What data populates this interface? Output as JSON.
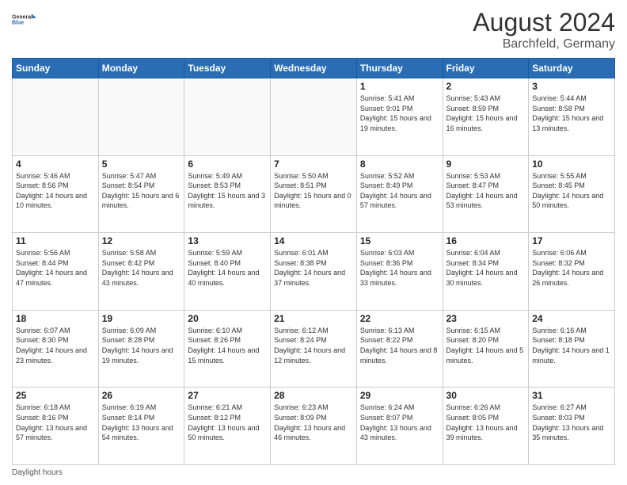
{
  "header": {
    "logo_general": "General",
    "logo_blue": "Blue",
    "month_year": "August 2024",
    "location": "Barchfeld, Germany"
  },
  "days_of_week": [
    "Sunday",
    "Monday",
    "Tuesday",
    "Wednesday",
    "Thursday",
    "Friday",
    "Saturday"
  ],
  "weeks": [
    [
      {
        "day": "",
        "empty": true
      },
      {
        "day": "",
        "empty": true
      },
      {
        "day": "",
        "empty": true
      },
      {
        "day": "",
        "empty": true
      },
      {
        "day": "1",
        "sunrise": "5:41 AM",
        "sunset": "9:01 PM",
        "daylight": "15 hours and 19 minutes."
      },
      {
        "day": "2",
        "sunrise": "5:43 AM",
        "sunset": "8:59 PM",
        "daylight": "15 hours and 16 minutes."
      },
      {
        "day": "3",
        "sunrise": "5:44 AM",
        "sunset": "8:58 PM",
        "daylight": "15 hours and 13 minutes."
      }
    ],
    [
      {
        "day": "4",
        "sunrise": "5:46 AM",
        "sunset": "8:56 PM",
        "daylight": "14 hours and 10 minutes."
      },
      {
        "day": "5",
        "sunrise": "5:47 AM",
        "sunset": "8:54 PM",
        "daylight": "15 hours and 6 minutes."
      },
      {
        "day": "6",
        "sunrise": "5:49 AM",
        "sunset": "8:53 PM",
        "daylight": "15 hours and 3 minutes."
      },
      {
        "day": "7",
        "sunrise": "5:50 AM",
        "sunset": "8:51 PM",
        "daylight": "15 hours and 0 minutes."
      },
      {
        "day": "8",
        "sunrise": "5:52 AM",
        "sunset": "8:49 PM",
        "daylight": "14 hours and 57 minutes."
      },
      {
        "day": "9",
        "sunrise": "5:53 AM",
        "sunset": "8:47 PM",
        "daylight": "14 hours and 53 minutes."
      },
      {
        "day": "10",
        "sunrise": "5:55 AM",
        "sunset": "8:45 PM",
        "daylight": "14 hours and 50 minutes."
      }
    ],
    [
      {
        "day": "11",
        "sunrise": "5:56 AM",
        "sunset": "8:44 PM",
        "daylight": "14 hours and 47 minutes."
      },
      {
        "day": "12",
        "sunrise": "5:58 AM",
        "sunset": "8:42 PM",
        "daylight": "14 hours and 43 minutes."
      },
      {
        "day": "13",
        "sunrise": "5:59 AM",
        "sunset": "8:40 PM",
        "daylight": "14 hours and 40 minutes."
      },
      {
        "day": "14",
        "sunrise": "6:01 AM",
        "sunset": "8:38 PM",
        "daylight": "14 hours and 37 minutes."
      },
      {
        "day": "15",
        "sunrise": "6:03 AM",
        "sunset": "8:36 PM",
        "daylight": "14 hours and 33 minutes."
      },
      {
        "day": "16",
        "sunrise": "6:04 AM",
        "sunset": "8:34 PM",
        "daylight": "14 hours and 30 minutes."
      },
      {
        "day": "17",
        "sunrise": "6:06 AM",
        "sunset": "8:32 PM",
        "daylight": "14 hours and 26 minutes."
      }
    ],
    [
      {
        "day": "18",
        "sunrise": "6:07 AM",
        "sunset": "8:30 PM",
        "daylight": "14 hours and 23 minutes."
      },
      {
        "day": "19",
        "sunrise": "6:09 AM",
        "sunset": "8:28 PM",
        "daylight": "14 hours and 19 minutes."
      },
      {
        "day": "20",
        "sunrise": "6:10 AM",
        "sunset": "8:26 PM",
        "daylight": "14 hours and 15 minutes."
      },
      {
        "day": "21",
        "sunrise": "6:12 AM",
        "sunset": "8:24 PM",
        "daylight": "14 hours and 12 minutes."
      },
      {
        "day": "22",
        "sunrise": "6:13 AM",
        "sunset": "8:22 PM",
        "daylight": "14 hours and 8 minutes."
      },
      {
        "day": "23",
        "sunrise": "6:15 AM",
        "sunset": "8:20 PM",
        "daylight": "14 hours and 5 minutes."
      },
      {
        "day": "24",
        "sunrise": "6:16 AM",
        "sunset": "8:18 PM",
        "daylight": "14 hours and 1 minute."
      }
    ],
    [
      {
        "day": "25",
        "sunrise": "6:18 AM",
        "sunset": "8:16 PM",
        "daylight": "13 hours and 57 minutes."
      },
      {
        "day": "26",
        "sunrise": "6:19 AM",
        "sunset": "8:14 PM",
        "daylight": "13 hours and 54 minutes."
      },
      {
        "day": "27",
        "sunrise": "6:21 AM",
        "sunset": "8:12 PM",
        "daylight": "13 hours and 50 minutes."
      },
      {
        "day": "28",
        "sunrise": "6:23 AM",
        "sunset": "8:09 PM",
        "daylight": "13 hours and 46 minutes."
      },
      {
        "day": "29",
        "sunrise": "6:24 AM",
        "sunset": "8:07 PM",
        "daylight": "13 hours and 43 minutes."
      },
      {
        "day": "30",
        "sunrise": "6:26 AM",
        "sunset": "8:05 PM",
        "daylight": "13 hours and 39 minutes."
      },
      {
        "day": "31",
        "sunrise": "6:27 AM",
        "sunset": "8:03 PM",
        "daylight": "13 hours and 35 minutes."
      }
    ]
  ],
  "footer": {
    "note": "Daylight hours"
  }
}
